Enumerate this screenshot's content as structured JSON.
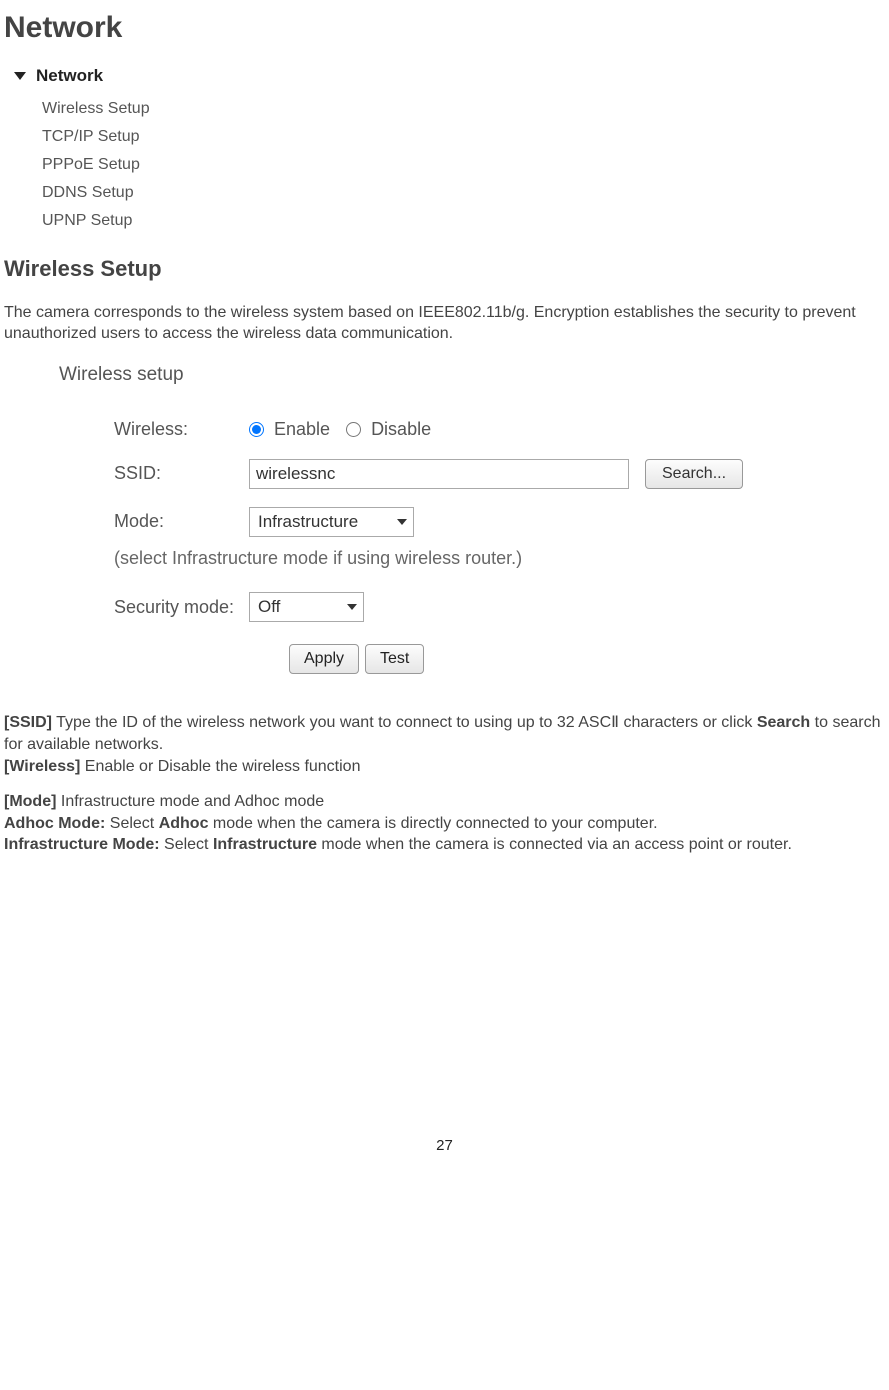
{
  "page": {
    "heading": "Network",
    "subheading": "Wireless Setup",
    "intro": "The camera corresponds to the wireless system based on IEEE802.11b/g. Encryption establishes the security to prevent unauthorized users to access the wireless data communication.",
    "page_number": "27"
  },
  "nav": {
    "header": "Network",
    "items": [
      "Wireless Setup",
      "TCP/IP Setup",
      "PPPoE Setup",
      "DDNS Setup",
      "UPNP Setup"
    ]
  },
  "panel": {
    "title": "Wireless setup",
    "wireless_label": "Wireless:",
    "enable_label": "Enable",
    "disable_label": "Disable",
    "ssid_label": "SSID:",
    "ssid_value": "wirelessnc",
    "search_label": "Search...",
    "mode_label": "Mode:",
    "mode_value": "Infrastructure",
    "mode_hint": "(select Infrastructure mode if using wireless router.)",
    "security_label": "Security mode:",
    "security_value": "Off",
    "apply_label": "Apply",
    "test_label": "Test"
  },
  "desc": {
    "ssid_tag": "[SSID]",
    "ssid_text": " Type the ID of the wireless network you want to connect to using up to 32 ASCⅡ characters or click ",
    "ssid_bold": "Search",
    "ssid_tail": " to search for available networks.",
    "wireless_tag": "[Wireless]",
    "wireless_text": " Enable or Disable the wireless function",
    "mode_tag": "[Mode]",
    "mode_text": " Infrastructure mode and Adhoc mode",
    "adhoc_lead": "Adhoc Mode:",
    "adhoc_mid": " Select ",
    "adhoc_bold": "Adhoc",
    "adhoc_tail": " mode when the camera is directly connected to your computer.",
    "infra_lead": "Infrastructure Mode:",
    "infra_mid": " Select ",
    "infra_bold": "Infrastructure",
    "infra_tail": " mode when the camera is connected via an access point or router."
  }
}
